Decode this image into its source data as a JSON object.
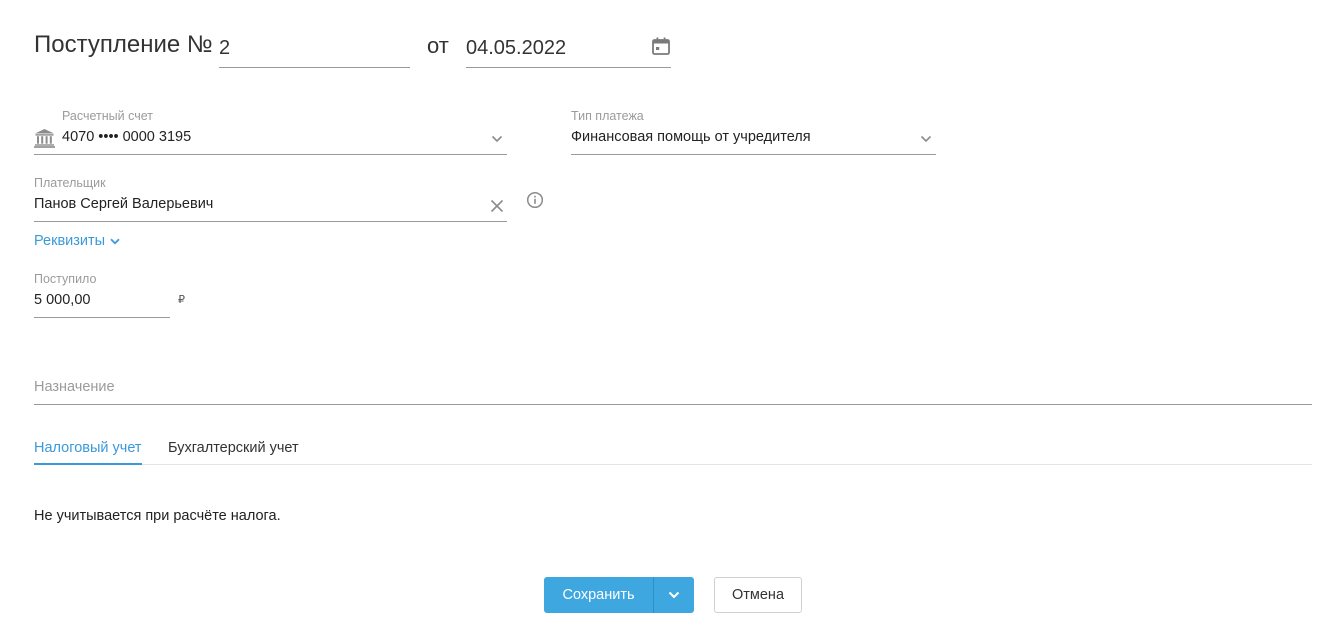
{
  "header": {
    "title": "Поступление №",
    "number": "2",
    "date_prefix": "от",
    "date": "04.05.2022"
  },
  "account": {
    "label": "Расчетный счет",
    "value": "4070 •••• 0000 3195"
  },
  "payment_type": {
    "label": "Тип платежа",
    "value": "Финансовая помощь от учредителя"
  },
  "payer": {
    "label": "Плательщик",
    "value": "Панов Сергей Валерьевич"
  },
  "requisites_link": "Реквизиты",
  "received": {
    "label": "Поступило",
    "value": "5 000,00",
    "currency": "₽"
  },
  "purpose": {
    "placeholder": "Назначение"
  },
  "tabs": [
    {
      "label": "Налоговый учет",
      "active": true
    },
    {
      "label": "Бухгалтерский учет",
      "active": false
    }
  ],
  "tax_note": "Не учитывается при расчёте налога.",
  "buttons": {
    "save": "Сохранить",
    "cancel": "Отмена"
  },
  "colors": {
    "accent": "#3a9ad9",
    "primary_button": "#3fa7e0"
  },
  "icons": [
    "calendar-icon",
    "bank-icon",
    "chevron-down-icon",
    "clear-icon",
    "info-icon"
  ]
}
